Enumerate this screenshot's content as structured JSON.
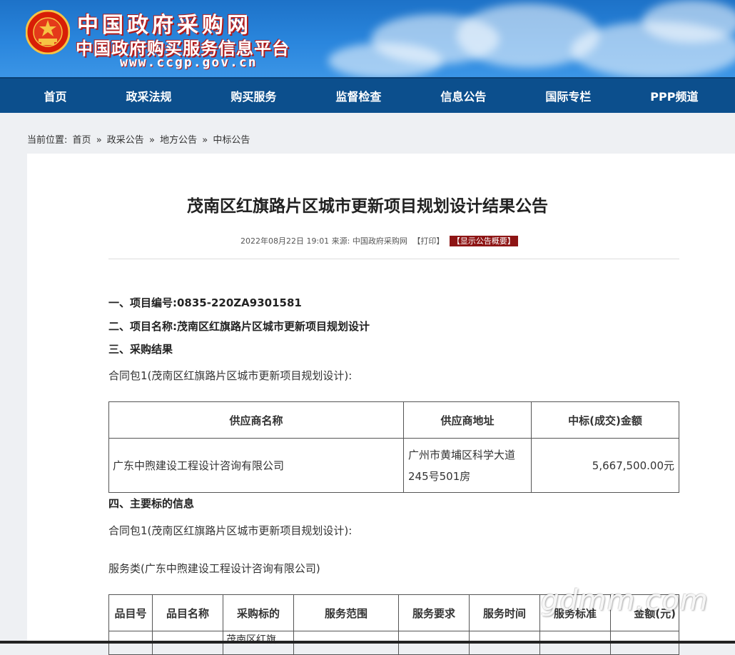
{
  "header": {
    "title": "中国政府采购网",
    "subtitle": "中国政府购买服务信息平台",
    "url": "www.ccgp.gov.cn"
  },
  "nav": {
    "items": [
      "首页",
      "政采法规",
      "购买服务",
      "监督检查",
      "信息公告",
      "国际专栏",
      "PPP频道"
    ]
  },
  "breadcrumb": {
    "prefix": "当前位置:",
    "items": [
      "首页",
      "政采公告",
      "地方公告",
      "中标公告"
    ],
    "sep": "»"
  },
  "article": {
    "title": "茂南区红旗路片区城市更新项目规划设计结果公告",
    "meta_date": "2022年08月22日 19:01 来源:",
    "meta_source": "中国政府采购网",
    "print_label": "【打印】",
    "summary_label": "【显示公告概要】",
    "sec1": "一、项目编号:0835-220ZA9301581",
    "sec2": "二、项目名称:茂南区红旗路片区城市更新项目规划设计",
    "sec3": "三、采购结果",
    "package1": "合同包1(茂南区红旗路片区城市更新项目规划设计):",
    "table1": {
      "headers": [
        "供应商名称",
        "供应商地址",
        "中标(成交)金额"
      ],
      "rows": [
        [
          "广东中煦建设工程设计咨询有限公司",
          "广州市黄埔区科学大道245号501房",
          "5,667,500.00元"
        ]
      ]
    },
    "sec4": "四、主要标的信息",
    "package1b": "合同包1(茂南区红旗路片区城市更新项目规划设计):",
    "service_type": "服务类(广东中煦建设工程设计咨询有限公司)",
    "table2": {
      "headers": [
        "品目号",
        "品目名称",
        "采购标的",
        "服务范围",
        "服务要求",
        "服务时间",
        "服务标准",
        "金额(元)"
      ],
      "partial_cell": "茂南区红旗"
    }
  },
  "watermark": "gdmm.com",
  "colors": {
    "banner": "#2a86dd",
    "nav": "#0c4f8d",
    "summary_btn": "#8d1414"
  }
}
